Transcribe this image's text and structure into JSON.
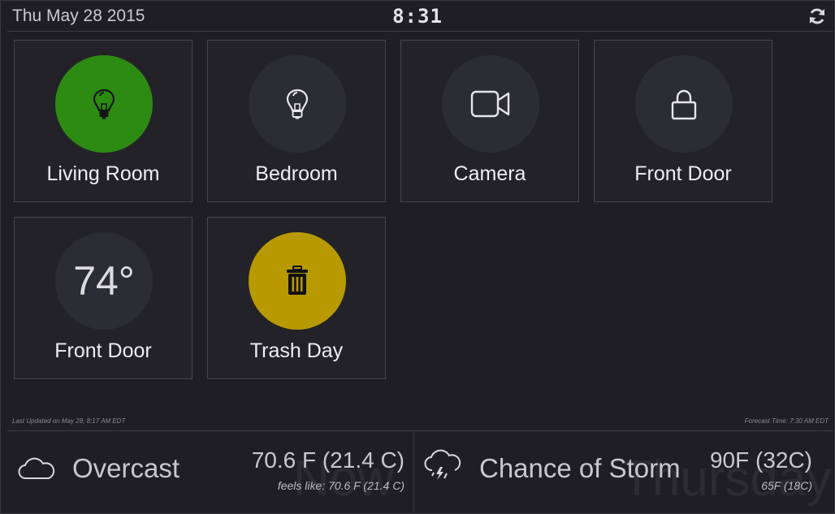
{
  "header": {
    "date": "Thu May 28 2015",
    "time": "8:31",
    "refresh_icon": "refresh-icon"
  },
  "tiles": [
    {
      "label": "Living Room",
      "icon": "lightbulb-icon",
      "state": "on",
      "color": "#2d8a12"
    },
    {
      "label": "Bedroom",
      "icon": "lightbulb-icon",
      "state": "off"
    },
    {
      "label": "Camera",
      "icon": "video-camera-icon"
    },
    {
      "label": "Front Door",
      "icon": "lock-icon"
    },
    {
      "label": "Front Door",
      "value": "74°",
      "icon": "temperature"
    },
    {
      "label": "Trash Day",
      "icon": "trash-icon",
      "color": "#b89a00"
    }
  ],
  "status": {
    "last_updated": "Last Updated on May 28, 8:17 AM EDT",
    "forecast_time": "Forecast Time: 7:30 AM EDT"
  },
  "weather": {
    "now": {
      "watermark": "Now",
      "condition": "Overcast",
      "temp": "70.6 F (21.4 C)",
      "feels_like": "feels like: 70.6 F (21.4 C)",
      "icon": "cloud-icon"
    },
    "forecast": {
      "watermark": "Thursday",
      "condition": "Chance of Storm",
      "temp": "90F (32C)",
      "low": "65F (18C)",
      "icon": "storm-cloud-icon"
    }
  }
}
